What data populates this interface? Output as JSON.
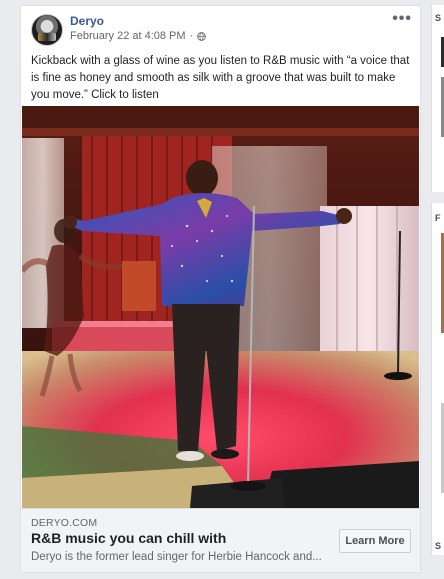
{
  "post": {
    "author": "Deryo",
    "timestamp": "February 22 at 4:08 PM",
    "separator": "·",
    "privacy_icon": "globe-icon",
    "more_label": "•••",
    "caption": "Kickback with a glass of wine as you listen to R&B music with “a voice that is fine as honey and smooth as silk with a groove that was built to make you move.” Click to listen"
  },
  "link": {
    "domain": "DERYO.COM",
    "title": "R&B music you can chill with",
    "description": "Deryo is the former lead singer for Herbie Hancock and...",
    "cta_label": "Learn More"
  },
  "sidebar": {
    "items": [
      {
        "letter": "S"
      },
      {
        "letter": "F"
      },
      {
        "letter": "S"
      }
    ]
  },
  "colors": {
    "link_blue": "#385898",
    "background": "#e9ebee",
    "stage_red": "#c8202a"
  }
}
